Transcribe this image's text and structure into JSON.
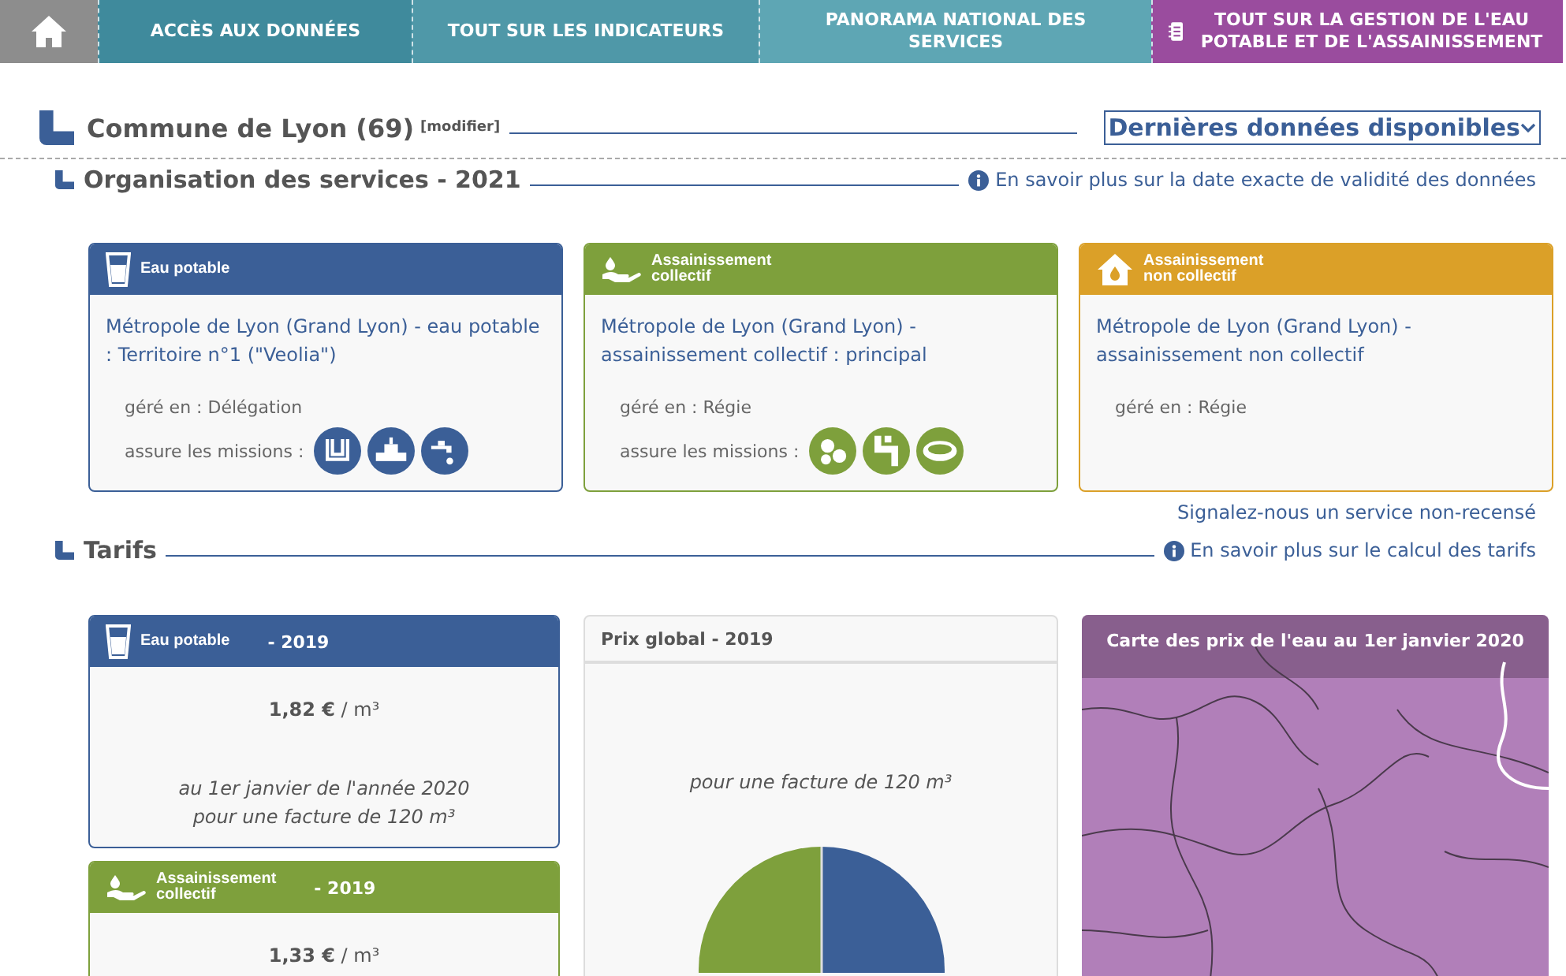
{
  "nav": {
    "tabs": [
      {
        "label": "ACCÈS AUX DONNÉES",
        "kind": "section"
      },
      {
        "label": "TOUT SUR LES INDICATEURS",
        "kind": "section"
      },
      {
        "label": "PANORAMA NATIONAL DES SERVICES",
        "kind": "section"
      },
      {
        "label": "TOUT SUR LA GESTION DE L'EAU POTABLE ET DE L'ASSAINISSEMENT",
        "kind": "featured"
      }
    ]
  },
  "commune": {
    "title": "Commune de Lyon (69)",
    "modify_link": "[modifier]",
    "period_select": "Dernières données disponibles"
  },
  "organisation": {
    "title": "Organisation des services - 2021",
    "info_link": "En savoir plus sur la date exacte de validité des données",
    "services": [
      {
        "kind": "water",
        "header": [
          "Eau potable"
        ],
        "name": "Métropole de Lyon (Grand Lyon) - eau potable : Territoire n°1 (\"Veolia\")",
        "management": "géré en : Délégation",
        "missions_label": "assure les missions :",
        "missions": [
          {
            "kind": "production"
          },
          {
            "kind": "transfer"
          },
          {
            "kind": "distribution"
          }
        ]
      },
      {
        "kind": "collective",
        "header": [
          "Assainissement",
          "collectif"
        ],
        "name": "Métropole de Lyon (Grand Lyon) - assainissement collectif : principal",
        "management": "géré en : Régie",
        "missions_label": "assure les missions :",
        "missions": [
          {
            "kind": "collection"
          },
          {
            "kind": "transport"
          },
          {
            "kind": "treatment"
          }
        ]
      },
      {
        "kind": "noncollective",
        "header": [
          "Assainissement",
          "non collectif"
        ],
        "name": "Métropole de Lyon (Grand Lyon) - assainissement non collectif",
        "management": "géré en : Régie"
      }
    ],
    "report_link": "Signalez-nous un service non-recensé"
  },
  "tarifs": {
    "title": "Tarifs",
    "info_link": "En savoir plus sur le calcul des tarifs",
    "prices": [
      {
        "kind": "water",
        "header": [
          "Eau potable"
        ],
        "year": "- 2019",
        "price": "**1,82 €** / m³",
        "notes": [
          "au 1er janvier de l'année 2020",
          "pour une facture de 120 m³"
        ]
      },
      {
        "kind": "collective",
        "header": [
          "Assainissement",
          "collectif"
        ],
        "year": "- 2019",
        "price": "**1,33 €** / m³"
      }
    ],
    "global": {
      "title": "Prix global - 2019",
      "note": "pour une facture de 120 m³"
    },
    "map": {
      "title": "Carte des prix de l'eau au 1er janvier 2020"
    }
  }
}
